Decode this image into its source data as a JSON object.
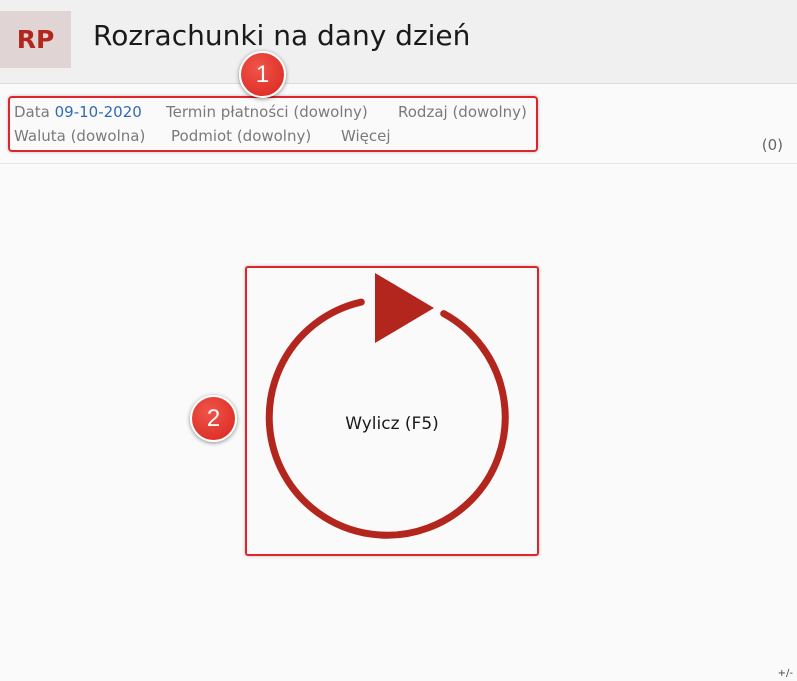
{
  "header": {
    "logo": "RP",
    "title": "Rozrachunki na dany dzień"
  },
  "filters": {
    "date_label": "Data",
    "date_value": "09-10-2020",
    "payment_term": "Termin płatności (dowolny)",
    "type": "Rodzaj (dowolny)",
    "currency": "Waluta (dowolna)",
    "entity": "Podmiot (dowolny)",
    "more": "Więcej",
    "count": "(0)"
  },
  "badges": {
    "first": "1",
    "second": "2"
  },
  "action": {
    "label": "Wylicz (F5)",
    "icon": "refresh-run-icon"
  },
  "footer": {
    "corner": "+/-"
  },
  "colors": {
    "accent": "#b3261e",
    "highlight": "#e0242c",
    "link": "#2e6bb8"
  }
}
